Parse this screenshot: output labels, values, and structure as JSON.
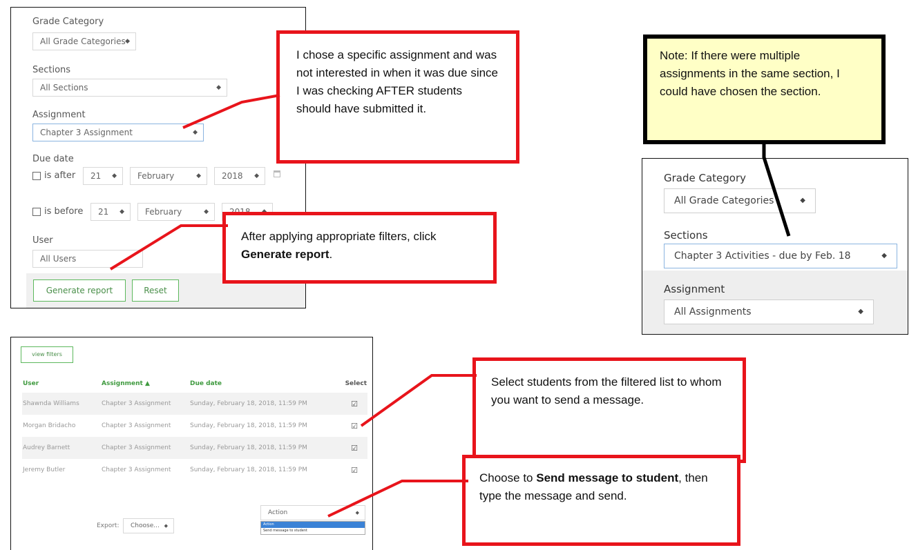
{
  "filter_panel": {
    "grade_category_label": "Grade Category",
    "grade_category_value": "All Grade Categories",
    "sections_label": "Sections",
    "sections_value": "All Sections",
    "assignment_label": "Assignment",
    "assignment_value": "Chapter 3 Assignment",
    "due_date_label": "Due date",
    "is_after_label": "is after",
    "is_before_label": "is before",
    "after_day": "21",
    "after_month": "February",
    "after_year": "2018",
    "before_day": "21",
    "before_month": "February",
    "before_year": "2018",
    "user_label": "User",
    "user_value": "All Users",
    "generate_label": "Generate report",
    "reset_label": "Reset"
  },
  "callouts": {
    "assignment_note": "I chose a specific assignment and was not interested in when it was due since I was checking AFTER students should have submitted it.",
    "generate_prefix": "After applying appropriate filters, click ",
    "generate_bold": "Generate report",
    "generate_suffix": ".",
    "select_students": "Select students from the filtered list to whom you want to send a message.",
    "send_prefix": "Choose to ",
    "send_bold": "Send message to student",
    "send_suffix": ", then type the message and send.",
    "note": "Note: If there were multiple assignments in the same section, I could have chosen the section."
  },
  "right_panel": {
    "grade_category_label": "Grade Category",
    "grade_category_value": "All Grade Categories",
    "sections_label": "Sections",
    "sections_value": "Chapter 3 Activities - due by Feb. 18",
    "assignment_label": "Assignment",
    "assignment_value": "All Assignments"
  },
  "report": {
    "view_filters_label": "view filters",
    "columns": [
      "User",
      "Assignment ▲",
      "Due date",
      "Select"
    ],
    "rows": [
      {
        "user": "Shawnda Williams",
        "assignment": "Chapter 3 Assignment",
        "due": "Sunday, February 18, 2018, 11:59 PM"
      },
      {
        "user": "Morgan Bridacho",
        "assignment": "Chapter 3 Assignment",
        "due": "Sunday, February 18, 2018, 11:59 PM"
      },
      {
        "user": "Audrey Barnett",
        "assignment": "Chapter 3 Assignment",
        "due": "Sunday, February 18, 2018, 11:59 PM"
      },
      {
        "user": "Jeremy Butler",
        "assignment": "Chapter 3 Assignment",
        "due": "Sunday, February 18, 2018, 11:59 PM"
      }
    ],
    "export_label": "Export:",
    "export_value": "Choose...",
    "action_value": "Action",
    "action_options": [
      "Action",
      "Send message to student"
    ]
  },
  "colors": {
    "callout_border": "#e8141b",
    "note_bg": "#ffffc6",
    "accent_green": "#3f9a3f"
  }
}
